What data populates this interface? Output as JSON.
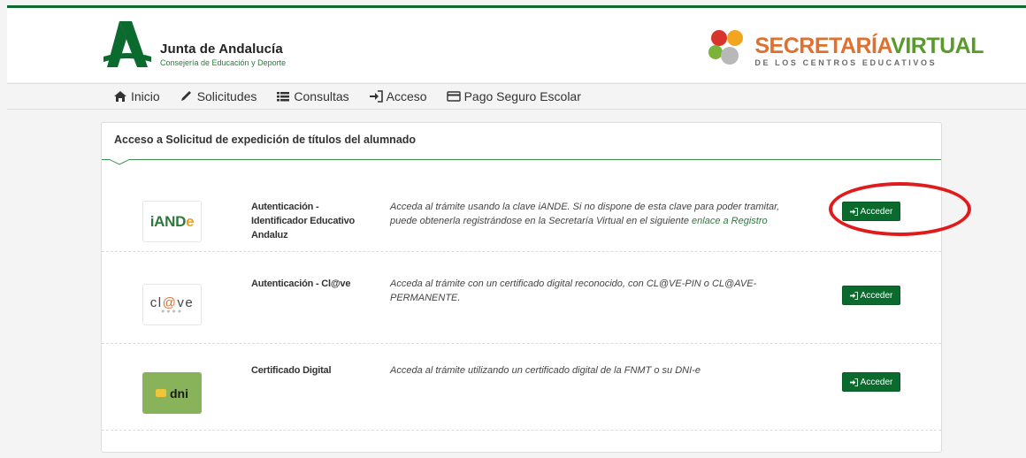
{
  "header": {
    "org_title": "Junta de Andalucía",
    "org_subtitle": "Consejería de Educación y Deporte",
    "brand_a": "SECRETARÍA",
    "brand_b": "VIRTUAL",
    "brand_sub": "DE LOS CENTROS EDUCATIVOS"
  },
  "nav": {
    "items": [
      {
        "label": "Inicio",
        "icon": "home-icon"
      },
      {
        "label": "Solicitudes",
        "icon": "pencil-icon"
      },
      {
        "label": "Consultas",
        "icon": "list-icon"
      },
      {
        "label": "Acceso",
        "icon": "sign-in-icon"
      },
      {
        "label": "Pago Seguro Escolar",
        "icon": "credit-card-icon"
      }
    ]
  },
  "panel": {
    "title": "Acceso a Solicitud de expedición de títulos del alumnado",
    "rows": [
      {
        "logo_text_a": "iAND",
        "logo_text_b": "e",
        "title": "Autenticación - Identificador Educativo Andaluz",
        "desc": "Acceda al trámite usando la clave iANDE. Si no dispone de esta clave para poder tramitar, puede obtenerla registrándose en la Secretaría Virtual en el siguiente ",
        "link": "enlace a Registro",
        "button": "Acceder"
      },
      {
        "logo_text_a": "cl",
        "logo_text_b": "@",
        "logo_text_c": "ve",
        "title": "Autenticación - Cl@ve",
        "desc": "Acceda al trámite con un certificado digital reconocido, con CL@VE-PIN o CL@AVE-PERMANENTE.",
        "button": "Acceder"
      },
      {
        "logo_text_a": "dni",
        "title": "Certificado Digital",
        "desc": "Acceda al trámite utilizando un certificado digital de la FNMT o su DNI-e",
        "button": "Acceder"
      }
    ]
  },
  "colors": {
    "brand_green": "#0b6a2e",
    "link_green": "#2b7a3c",
    "highlight_red": "#e01b1b"
  }
}
